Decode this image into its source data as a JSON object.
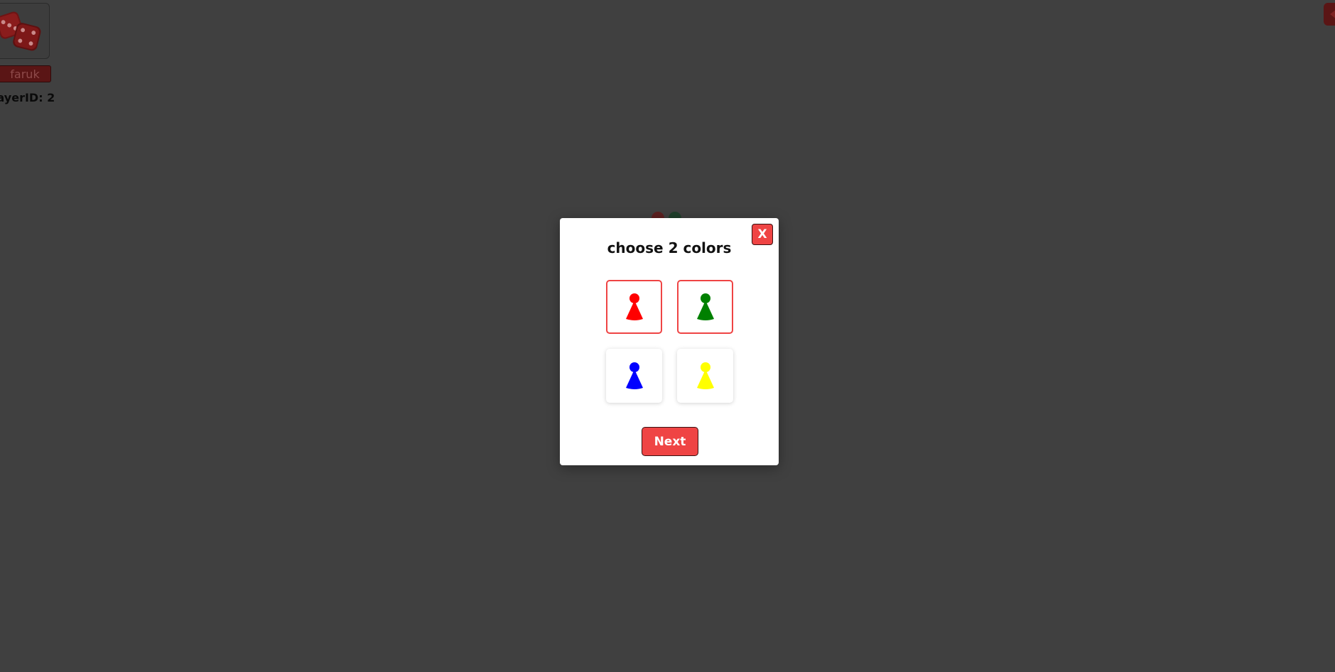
{
  "player": {
    "name": "faruk",
    "id_text": "layerID: 2"
  },
  "dice": {
    "icon": "dice-icon",
    "color": "#7a1a1a"
  },
  "modal": {
    "title": "choose 2 colors",
    "close_label": "X",
    "next_label": "Next",
    "colors": [
      {
        "name": "red",
        "hex": "#ff0000",
        "selected": true
      },
      {
        "name": "green",
        "hex": "#008000",
        "selected": true
      },
      {
        "name": "blue",
        "hex": "#0000ff",
        "selected": false
      },
      {
        "name": "yellow",
        "hex": "#ffff00",
        "selected": false
      }
    ]
  },
  "colors": {
    "accent": "#ef4444",
    "backdrop": "#404040"
  }
}
